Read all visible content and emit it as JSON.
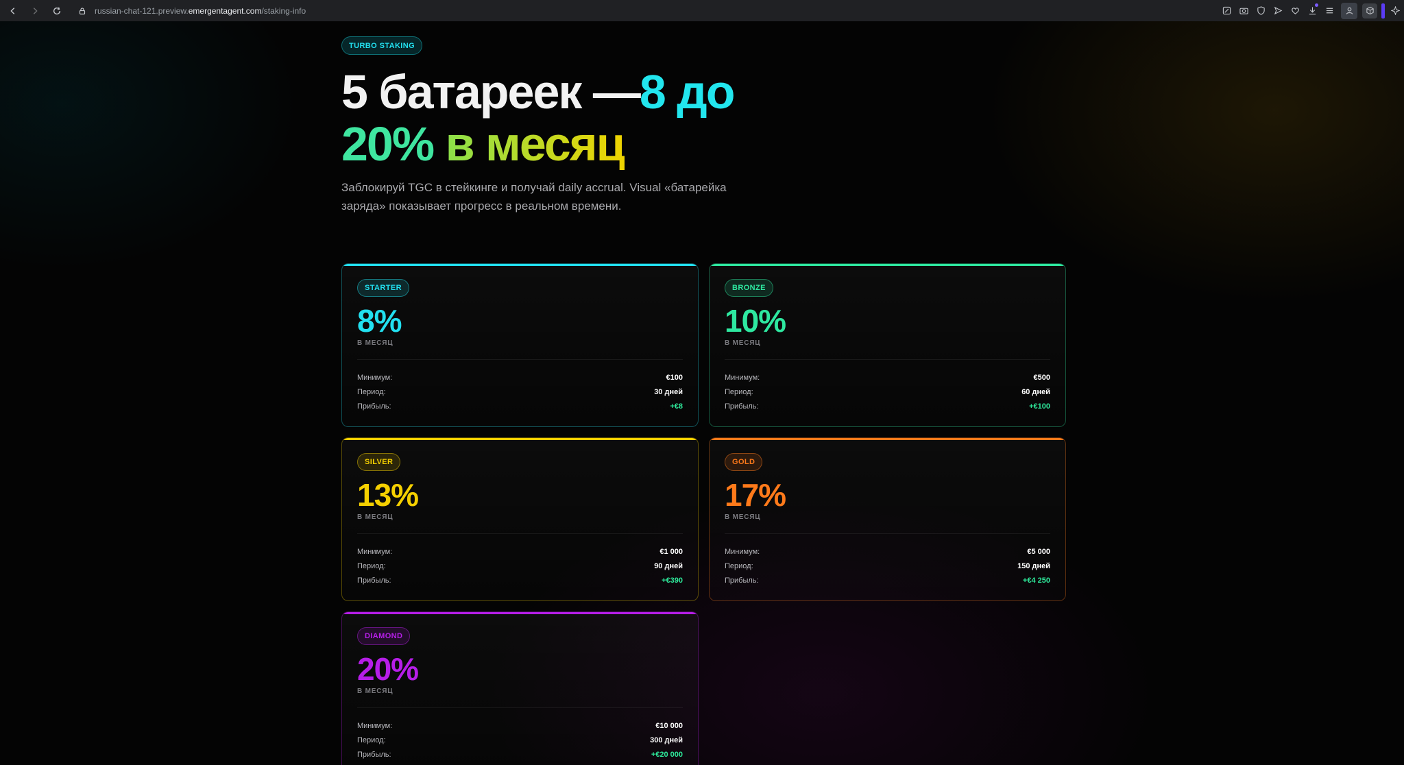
{
  "browser": {
    "url_pre": "russian-chat-121.preview.",
    "url_host": "emergentagent.com",
    "url_post": "/staking-info"
  },
  "hero": {
    "badge": "TURBO STAKING",
    "title_white": "5 батареек —",
    "title_cyan": "8 до",
    "title_green": "20%",
    "title_yellow": "в месяц",
    "subtitle": "Заблокируй TGC в стейкинге и получай daily accrual. Visual «батарейка заряда» показывает прогресс в реальном времени."
  },
  "labels": {
    "per_month": "В МЕСЯЦ",
    "min": "Минимум:",
    "period": "Период:",
    "profit": "Прибыль:"
  },
  "tiers": [
    {
      "name": "STARTER",
      "rate": "8%",
      "min": "€100",
      "period": "30 дней",
      "profit": "+€8",
      "color": "#22e0f0"
    },
    {
      "name": "BRONZE",
      "rate": "10%",
      "min": "€500",
      "period": "60 дней",
      "profit": "+€100",
      "color": "#2ee8a0"
    },
    {
      "name": "SILVER",
      "rate": "13%",
      "min": "€1 000",
      "period": "90 дней",
      "profit": "+€390",
      "color": "#f5d000"
    },
    {
      "name": "GOLD",
      "rate": "17%",
      "min": "€5 000",
      "period": "150 дней",
      "profit": "+€4 250",
      "color": "#ff7a1a"
    },
    {
      "name": "DIAMOND",
      "rate": "20%",
      "min": "€10 000",
      "period": "300 дней",
      "profit": "+€20 000",
      "color": "#b61ee8"
    }
  ]
}
